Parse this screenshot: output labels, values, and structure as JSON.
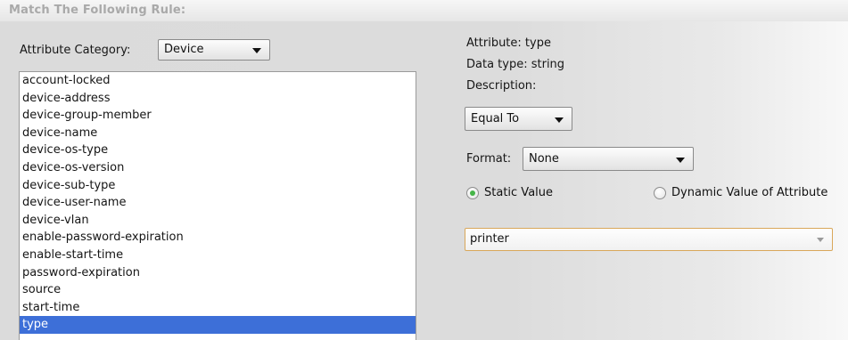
{
  "heading": "Match The Following Rule:",
  "attribute_category": {
    "label": "Attribute Category:",
    "selected": "Device"
  },
  "attribute_list": {
    "items": [
      "account-locked",
      "device-address",
      "device-group-member",
      "device-name",
      "device-os-type",
      "device-os-version",
      "device-sub-type",
      "device-user-name",
      "device-vlan",
      "enable-password-expiration",
      "enable-start-time",
      "password-expiration",
      "source",
      "start-time",
      "type"
    ],
    "selected": "type"
  },
  "details": {
    "attribute": "Attribute: type",
    "data_type": "Data type: string",
    "description": "Description:"
  },
  "operator": {
    "selected": "Equal To"
  },
  "format": {
    "label": "Format:",
    "selected": "None"
  },
  "value_type": {
    "static_label": "Static Value",
    "dynamic_label": "Dynamic Value of Attribute",
    "selected": "static"
  },
  "value": {
    "current": "printer"
  },
  "colors": {
    "selection": "#3d6fd8",
    "radio_checked": "#46b548",
    "value_border": "#d9a75a"
  }
}
